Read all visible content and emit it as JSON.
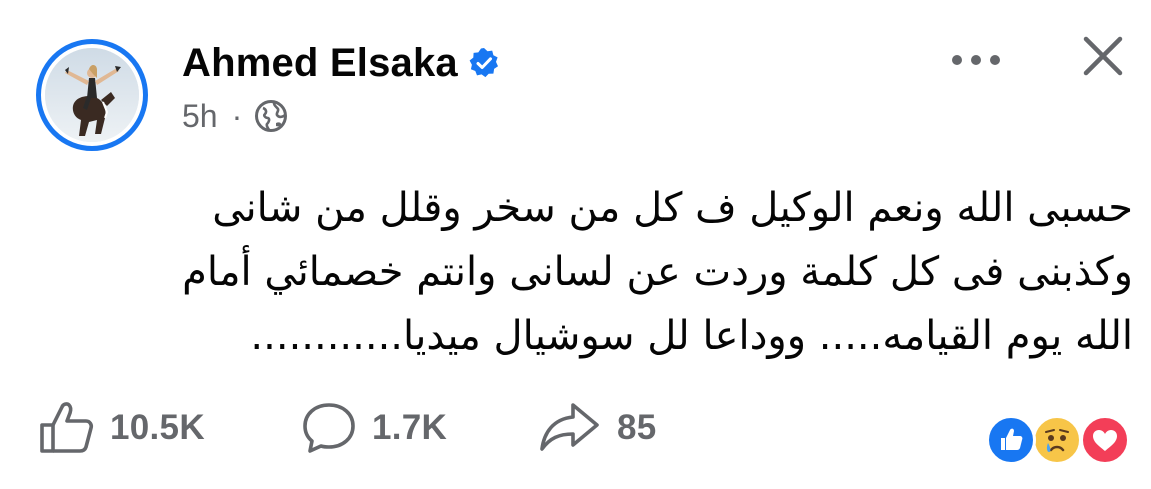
{
  "post": {
    "author": {
      "name": "Ahmed Elsaka",
      "verified": true
    },
    "meta": {
      "timestamp": "5h",
      "separator": "·",
      "audience_icon": "globe-icon"
    },
    "text_lines": [
      "حسبى الله ونعم الوكيل ف كل من سخر وقلل من شانى",
      "وكذبنى فى كل كلمة وردت عن لسانى وانتم خصمائي أمام",
      "الله يوم القيامه..... ووداعا لل سوشيال ميديا............"
    ],
    "stats": {
      "likes": "10.5K",
      "comments": "1.7K",
      "shares": "85"
    },
    "reactions": [
      "like-reaction-icon",
      "sad-reaction-icon",
      "love-reaction-icon"
    ]
  },
  "colors": {
    "accent": "#1877f2",
    "secondary_text": "#65676b",
    "primary_text": "#050505",
    "like_blue": "#1877f2",
    "sad_yellow": "#f7c548",
    "love_red": "#f33e58"
  }
}
